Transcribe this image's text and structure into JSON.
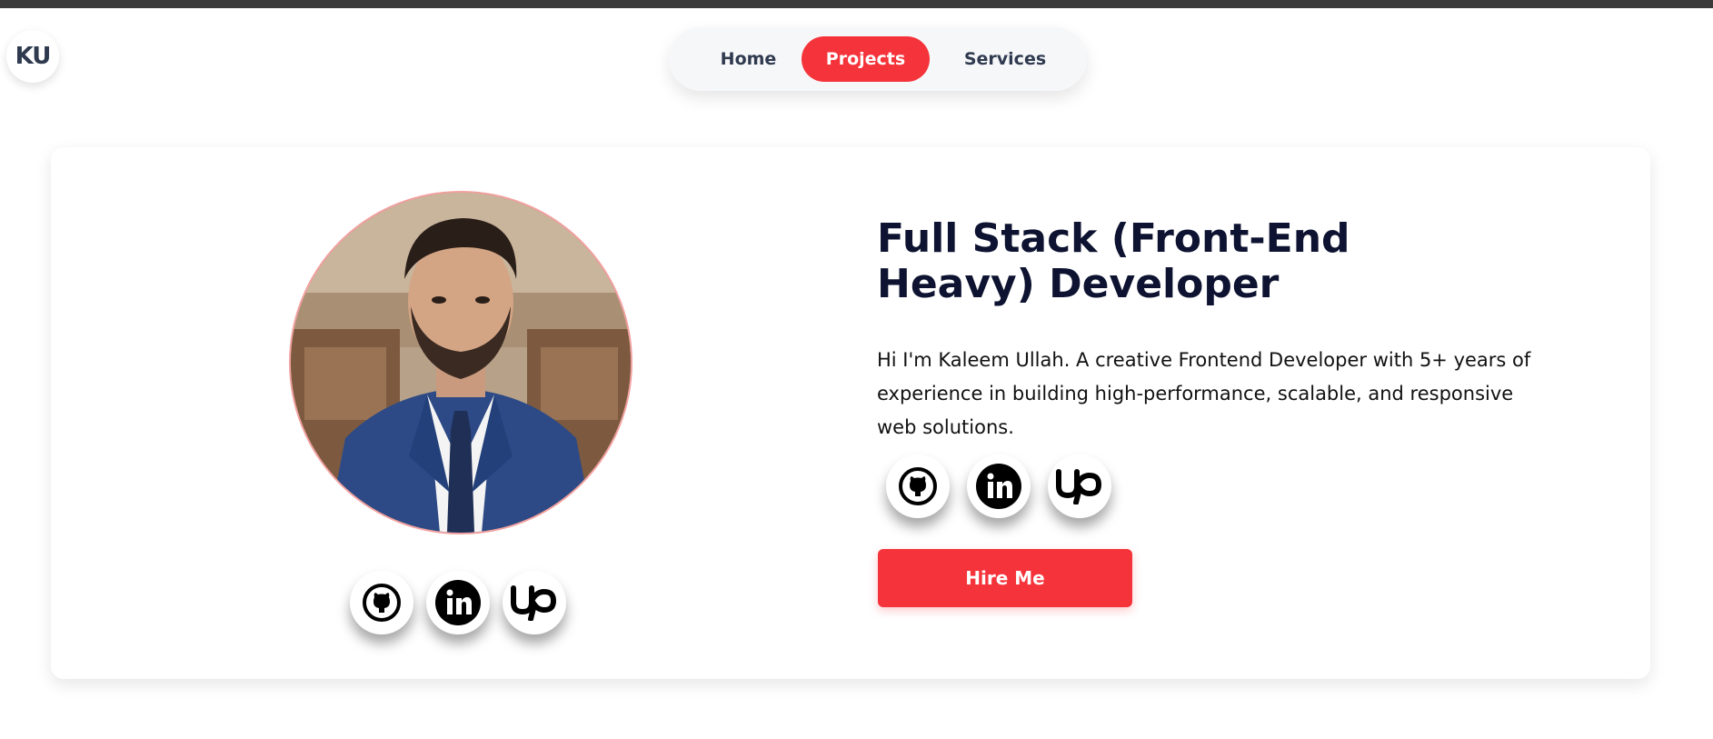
{
  "logo": {
    "initials": "KU"
  },
  "nav": {
    "items": [
      {
        "label": "Home",
        "active": false
      },
      {
        "label": "Projects",
        "active": true
      },
      {
        "label": "Services",
        "active": false
      }
    ],
    "accent_color": "#f5333a"
  },
  "hero": {
    "heading": "Full Stack (Front-End Heavy) Developer",
    "intro": "Hi I'm Kaleem Ullah. A creative Frontend Developer with 5+ years of experience in building high-performance, scalable, and responsive web solutions.",
    "hire_label": "Hire Me",
    "photo_icon": "profile-photo",
    "social_icons": [
      "github-icon",
      "linkedin-icon",
      "upwork-icon"
    ]
  },
  "colors": {
    "heading": "#0d1330",
    "button": "#f5333a",
    "nav_text": "#2f3a4f"
  }
}
